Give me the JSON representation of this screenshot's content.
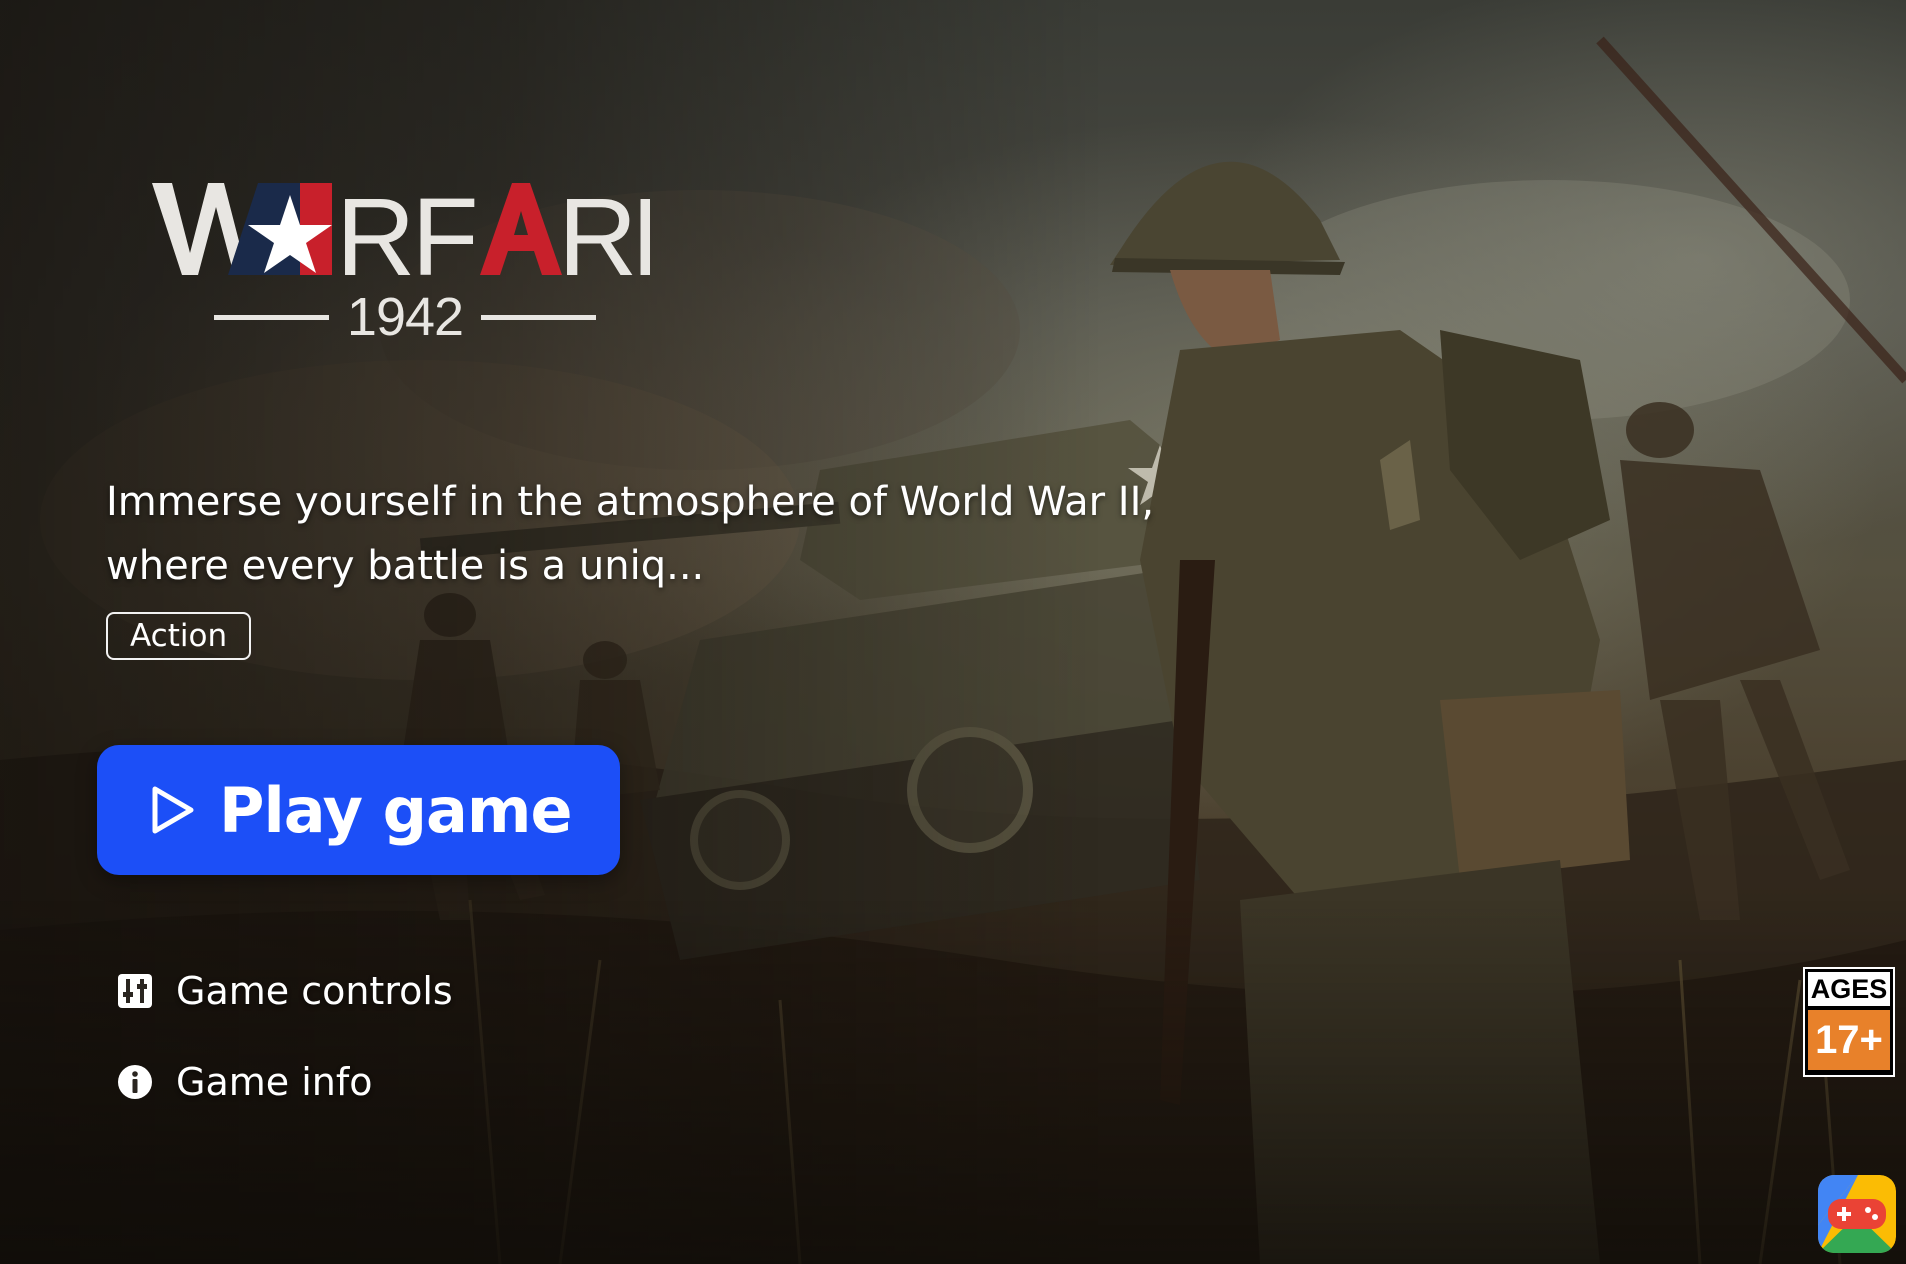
{
  "game": {
    "logo_word": "WARFARE",
    "logo_year": "1942",
    "description_line1": "Immerse yourself in the atmosphere of World War II,",
    "description_line2": "where every battle is a uniq...",
    "genre_tag": "Action"
  },
  "actions": {
    "play_label": "Play game",
    "controls_label": "Game controls",
    "info_label": "Game info"
  },
  "rating": {
    "top": "AGES",
    "bottom": "17+"
  },
  "icons": {
    "play": "play-triangle-icon",
    "controls": "sliders-icon",
    "info": "info-circle-icon",
    "app": "game-controller-icon"
  },
  "colors": {
    "play_button": "#1c4ff7",
    "rating_orange": "#e8812a",
    "logo_red": "#c8202b",
    "logo_navy": "#1a2a4a"
  }
}
